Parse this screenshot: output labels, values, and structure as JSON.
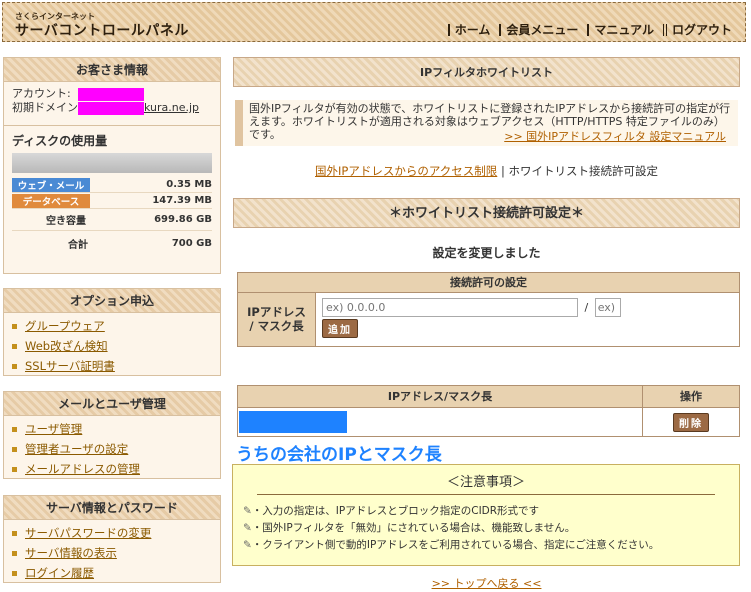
{
  "header": {
    "logo_sub": "さくらインターネット",
    "logo": "サーバコントロールパネル",
    "nav": [
      "ホーム",
      "会員メニュー",
      "マニュアル",
      "ログアウト"
    ]
  },
  "customer": {
    "title": "お客さま情報",
    "account_label": "アカウント:",
    "domain_label": "初期ドメイン:",
    "domain_suffix": "kura.ne.jp",
    "disk_title": "ディスクの使用量",
    "rows": [
      {
        "label": "ウェブ・メール",
        "value": "0.35 MB",
        "color": "#4a8ad4"
      },
      {
        "label": "データベース",
        "value": "147.39 MB",
        "color": "#e08a3c"
      },
      {
        "label": "空き容量",
        "value": "699.86 GB"
      },
      {
        "label": "合計",
        "value": "700 GB"
      }
    ]
  },
  "options": {
    "title": "オプション申込",
    "items": [
      "グループウェア",
      "Web改ざん検知",
      "SSLサーバ証明書"
    ]
  },
  "mailusers": {
    "title": "メールとユーザ管理",
    "items": [
      "ユーザ管理",
      "管理者ユーザの設定",
      "メールアドレスの管理"
    ]
  },
  "serverinfo": {
    "title": "サーバ情報とパスワード",
    "items": [
      "サーバパスワードの変更",
      "サーバ情報の表示",
      "ログイン履歴"
    ]
  },
  "main": {
    "title": "IPフィルタホワイトリスト",
    "notice": "国外IPフィルタが有効の状態で、ホワイトリストに登録されたIPアドレスから接続許可の指定が行えます。ホワイトリストが適用される対象はウェブアクセス（HTTP/HTTPS 特定ファイルのみ）です。",
    "notice_link": ">> 国外IPアドレスフィルタ 設定マニュアル",
    "sublink1": "国外IPアドレスからのアクセス制限",
    "sublink_sep": "|",
    "sublink2": "ホワイトリスト接続許可設定",
    "section": "＊ホワイトリスト接続許可設定＊",
    "changed": "設定を変更しました",
    "form": {
      "title": "接続許可の設定",
      "label": "IPアドレス / マスク長",
      "ip_placeholder": "ex) 0.0.0.0",
      "sep": "/",
      "mask_placeholder": "ex) :",
      "add": "追加"
    },
    "list": {
      "col1": "IPアドレス/マスク長",
      "col2": "操作",
      "delete": "削除"
    },
    "annotation": "うちの会社のIPとマスク長",
    "caution": {
      "title": "＜注意事項＞",
      "items": [
        "・入力の指定は、IPアドレスとブロック指定のCIDR形式です",
        "・国外IPフィルタを「無効」にされている場合は、機能致しません。",
        "・クライアント側で動的IPアドレスをご利用されている場合、指定にご注意ください。"
      ]
    },
    "top_link": ">> トップへ戻る <<"
  }
}
